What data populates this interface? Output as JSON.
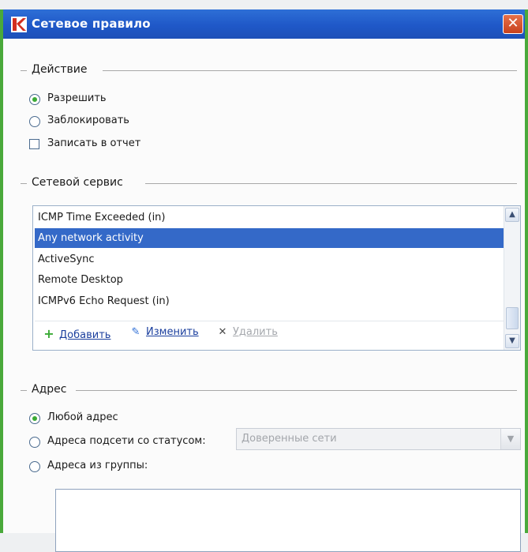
{
  "window": {
    "title": "Сетевое правило",
    "close_symbol": "✕"
  },
  "action": {
    "title": "Действие",
    "options": [
      "Разрешить",
      "Заблокировать"
    ],
    "selected": "Разрешить",
    "log_label": "Записать в отчет",
    "log_checked": false
  },
  "service": {
    "title": "Сетевой сервис",
    "items": [
      "ICMP Time Exceeded (in)",
      "Any network activity",
      "ActiveSync",
      "Remote Desktop",
      "ICMPv6 Echo Request (in)"
    ],
    "selected": "Any network activity",
    "actions": {
      "add": "Добавить",
      "edit": "Изменить",
      "delete": "Удалить"
    }
  },
  "address": {
    "title": "Адрес",
    "options": [
      "Любой адрес",
      "Адреса подсети со статусом:",
      "Адреса из группы:"
    ],
    "selected": "Любой адрес",
    "subnet_status": "Доверенные сети"
  },
  "colors": {
    "titlebar": "#1f58c8",
    "selection": "#3469c8",
    "frame": "#4aa93b",
    "add_icon": "#3aaa35",
    "edit_icon": "#2f6fd6"
  },
  "icons": [
    "app-logo-icon",
    "close-icon",
    "plus-icon",
    "pencil-icon",
    "x-icon",
    "chevron-up-icon",
    "chevron-down-icon"
  ]
}
